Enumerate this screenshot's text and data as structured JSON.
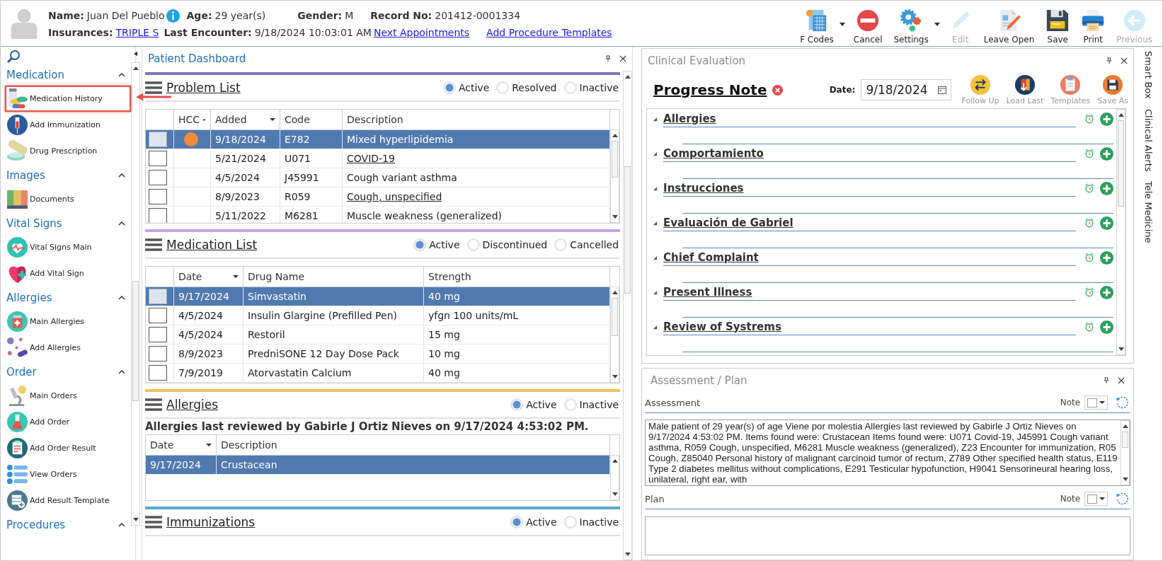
{
  "patient": {
    "name_label": "Name:",
    "name": "Juan Del Pueblo",
    "age_label": "Age:",
    "age": "29 year(s)",
    "gender_label": "Gender:",
    "gender": "M",
    "record_label": "Record No:",
    "record": "201412-0001334",
    "insurances_label": "Insurances:",
    "insurance": "TRIPLE S",
    "last_encounter_label": "Last Encounter:",
    "last_encounter": "9/18/2024 10:03:01 AM",
    "links": [
      "Next Appointments",
      "Add Procedure Templates"
    ]
  },
  "toolbar": [
    {
      "label": "F Codes",
      "kind": "calculator",
      "dropdown": true,
      "disabled": false
    },
    {
      "label": "Cancel",
      "kind": "no-entry",
      "dropdown": false,
      "disabled": false
    },
    {
      "label": "Settings",
      "kind": "gears",
      "dropdown": true,
      "disabled": false
    },
    {
      "label": "Edit",
      "kind": "pencil",
      "dropdown": false,
      "disabled": true
    },
    {
      "label": "Leave Open",
      "kind": "document-pen",
      "dropdown": false,
      "disabled": false
    },
    {
      "label": "Save",
      "kind": "floppy",
      "dropdown": false,
      "disabled": false
    },
    {
      "label": "Print",
      "kind": "printer",
      "dropdown": false,
      "disabled": false
    },
    {
      "label": "Previous",
      "kind": "back-arrow",
      "dropdown": false,
      "disabled": true
    }
  ],
  "sidebar": {
    "groups": [
      {
        "title": "Medication",
        "expanded": true,
        "items": [
          {
            "label": "Medication History",
            "kind": "pill-bottle",
            "highlighted": true
          },
          {
            "label": "Add Immunization",
            "kind": "syringe",
            "highlighted": false
          },
          {
            "label": "Drug Prescription",
            "kind": "capsule",
            "highlighted": false
          }
        ]
      },
      {
        "title": "Images",
        "expanded": true,
        "items": [
          {
            "label": "Documents",
            "kind": "binders",
            "highlighted": false
          }
        ]
      },
      {
        "title": "Vital Signs",
        "expanded": true,
        "items": [
          {
            "label": "Vital Signs Main",
            "kind": "heart-monitor",
            "highlighted": false
          },
          {
            "label": "Add Vital Sign",
            "kind": "heart-plus",
            "highlighted": false
          }
        ]
      },
      {
        "title": "Allergies",
        "expanded": true,
        "items": [
          {
            "label": "Main Allergies",
            "kind": "medicine-bottle",
            "highlighted": false
          },
          {
            "label": "Add Allergies",
            "kind": "pills",
            "highlighted": false
          }
        ]
      },
      {
        "title": "Order",
        "expanded": true,
        "items": [
          {
            "label": "Main Orders",
            "kind": "microscope",
            "highlighted": false
          },
          {
            "label": "Add Order",
            "kind": "test-tube",
            "highlighted": false
          },
          {
            "label": "Add Order Result",
            "kind": "clipboard",
            "highlighted": false
          },
          {
            "label": "View Orders",
            "kind": "list",
            "highlighted": false
          },
          {
            "label": "Add Result Template",
            "kind": "server-plus",
            "highlighted": false
          }
        ]
      },
      {
        "title": "Procedures",
        "expanded": true
      }
    ]
  },
  "dashboard": {
    "title": "Patient Dashboard",
    "sections": [
      {
        "kind": "problems",
        "title": "Problem List",
        "color": "#7b74bd",
        "filters": [
          {
            "label": "Active",
            "selected": true
          },
          {
            "label": "Resolved",
            "selected": false
          },
          {
            "label": "Inactive",
            "selected": false
          }
        ],
        "columns": [
          {
            "label": "HCC",
            "kind": "indicator",
            "sorted": true,
            "dropdown": false
          },
          {
            "label": "Added",
            "kind": "text",
            "sorted": false,
            "dropdown": true
          },
          {
            "label": "Code",
            "kind": "text",
            "sorted": false,
            "dropdown": false
          },
          {
            "label": "Description",
            "kind": "text",
            "sorted": false,
            "dropdown": false
          }
        ],
        "rows": [
          {
            "selected": true,
            "hcc": true,
            "linked": false,
            "cells": [
              "",
              "9/18/2024",
              "E782",
              "Mixed hyperlipidemia"
            ]
          },
          {
            "selected": false,
            "hcc": false,
            "linked": true,
            "cells": [
              "",
              "5/21/2024",
              "U071",
              "COVID-19"
            ]
          },
          {
            "selected": false,
            "hcc": false,
            "linked": false,
            "cells": [
              "",
              "4/5/2024",
              "J45991",
              "Cough variant asthma"
            ]
          },
          {
            "selected": false,
            "hcc": false,
            "linked": true,
            "cells": [
              "",
              "8/9/2023",
              "R059",
              "Cough, unspecified"
            ]
          },
          {
            "selected": false,
            "hcc": false,
            "linked": false,
            "cells": [
              "",
              "5/11/2022",
              "M6281",
              "Muscle weakness (generalized)"
            ]
          }
        ]
      },
      {
        "kind": "medications",
        "title": "Medication List",
        "color": "#c7a3e3",
        "filters": [
          {
            "label": "Active",
            "selected": true
          },
          {
            "label": "Discontinued",
            "selected": false
          },
          {
            "label": "Cancelled",
            "selected": false
          }
        ],
        "columns": [
          {
            "label": "Date",
            "kind": "text",
            "sorted": false,
            "dropdown": true
          },
          {
            "label": "Drug Name",
            "kind": "text",
            "sorted": false,
            "dropdown": false
          },
          {
            "label": "Strength",
            "kind": "text",
            "sorted": false,
            "dropdown": false
          }
        ],
        "rows": [
          {
            "selected": true,
            "linked": false,
            "cells": [
              "9/17/2024",
              "Simvastatin",
              "40 mg"
            ]
          },
          {
            "selected": false,
            "linked": false,
            "cells": [
              "4/5/2024",
              "Insulin Glargine (Prefilled Pen)",
              "yfgn 100 units/mL"
            ]
          },
          {
            "selected": false,
            "linked": false,
            "cells": [
              "4/5/2024",
              "Restoril",
              "15 mg"
            ]
          },
          {
            "selected": false,
            "linked": false,
            "cells": [
              "8/9/2023",
              "PredniSONE 12 Day Dose Pack",
              "10 mg"
            ]
          },
          {
            "selected": false,
            "linked": false,
            "cells": [
              "7/9/2019",
              "Atorvastatin Calcium",
              "40 mg"
            ]
          }
        ]
      },
      {
        "kind": "allergies",
        "title": "Allergies",
        "color": "#f0bf5c",
        "filters": [
          {
            "label": "Active",
            "selected": true
          },
          {
            "label": "Inactive",
            "selected": false
          }
        ],
        "note": "Allergies last reviewed by Gabirle J Ortiz Nieves on 9/17/2024 4:53:02 PM.",
        "columns": [
          {
            "label": "Date",
            "kind": "text",
            "sorted": false,
            "dropdown": true
          },
          {
            "label": "Description",
            "kind": "text",
            "sorted": false,
            "dropdown": false
          }
        ],
        "rows": [
          {
            "selected": true,
            "linked": false,
            "cells": [
              "9/17/2024",
              "Crustacean"
            ]
          }
        ]
      },
      {
        "kind": "immunizations",
        "title": "Immunizations",
        "color": "#5aa8cc",
        "filters": [
          {
            "label": "Active",
            "selected": true
          },
          {
            "label": "Inactive",
            "selected": false
          }
        ]
      }
    ]
  },
  "clinical": {
    "title": "Clinical Evaluation",
    "note_title": "Progress Note",
    "date_label": "Date:",
    "date": "9/18/2024",
    "actions": [
      {
        "label": "Follow Up",
        "kind": "swap"
      },
      {
        "label": "Load Last",
        "kind": "book-down"
      },
      {
        "label": "Templates",
        "kind": "clipboard"
      },
      {
        "label": "Save As",
        "kind": "floppy"
      }
    ],
    "sections": [
      {
        "title": "Allergies",
        "expanded": true
      },
      {
        "title": "Comportamiento",
        "expanded": true
      },
      {
        "title": "Instrucciones",
        "expanded": true
      },
      {
        "title": "Evaluación de Gabriel",
        "expanded": true
      },
      {
        "title": "Chief Complaint",
        "expanded": true
      },
      {
        "title": "Present Illness",
        "expanded": true
      },
      {
        "title": "Review of Systrems",
        "expanded": true
      }
    ]
  },
  "assessment_plan": {
    "title": "Assessment / Plan",
    "assessment_label": "Assessment",
    "assessment_note_label": "Note",
    "assessment_text": "Male patient of 29 year(s) of age Viene por molestia     Allergies last reviewed by Gabirle J Ortiz Nieves on 9/17/2024 4:53:02 PM.    Items found were:  Crustacean  Items found were:  U071 Covid-19, J45991 Cough variant asthma, R059 Cough, unspecified, M6281 Muscle weakness (generalized), Z23 Encounter for immunization, R05 Cough, Z85040 Personal history of malignant carcinoid tumor of rectum, Z789 Other specified health status, E119 Type 2 diabetes mellitus without complications, E291 Testicular hypofunction, H9041 Sensorineural hearing loss, unilateral, right ear, with",
    "plan_label": "Plan",
    "plan_note_label": "Note"
  },
  "side_tabs": [
    "Smart Box",
    "Clinical Alerts",
    "Tele Medicine"
  ]
}
